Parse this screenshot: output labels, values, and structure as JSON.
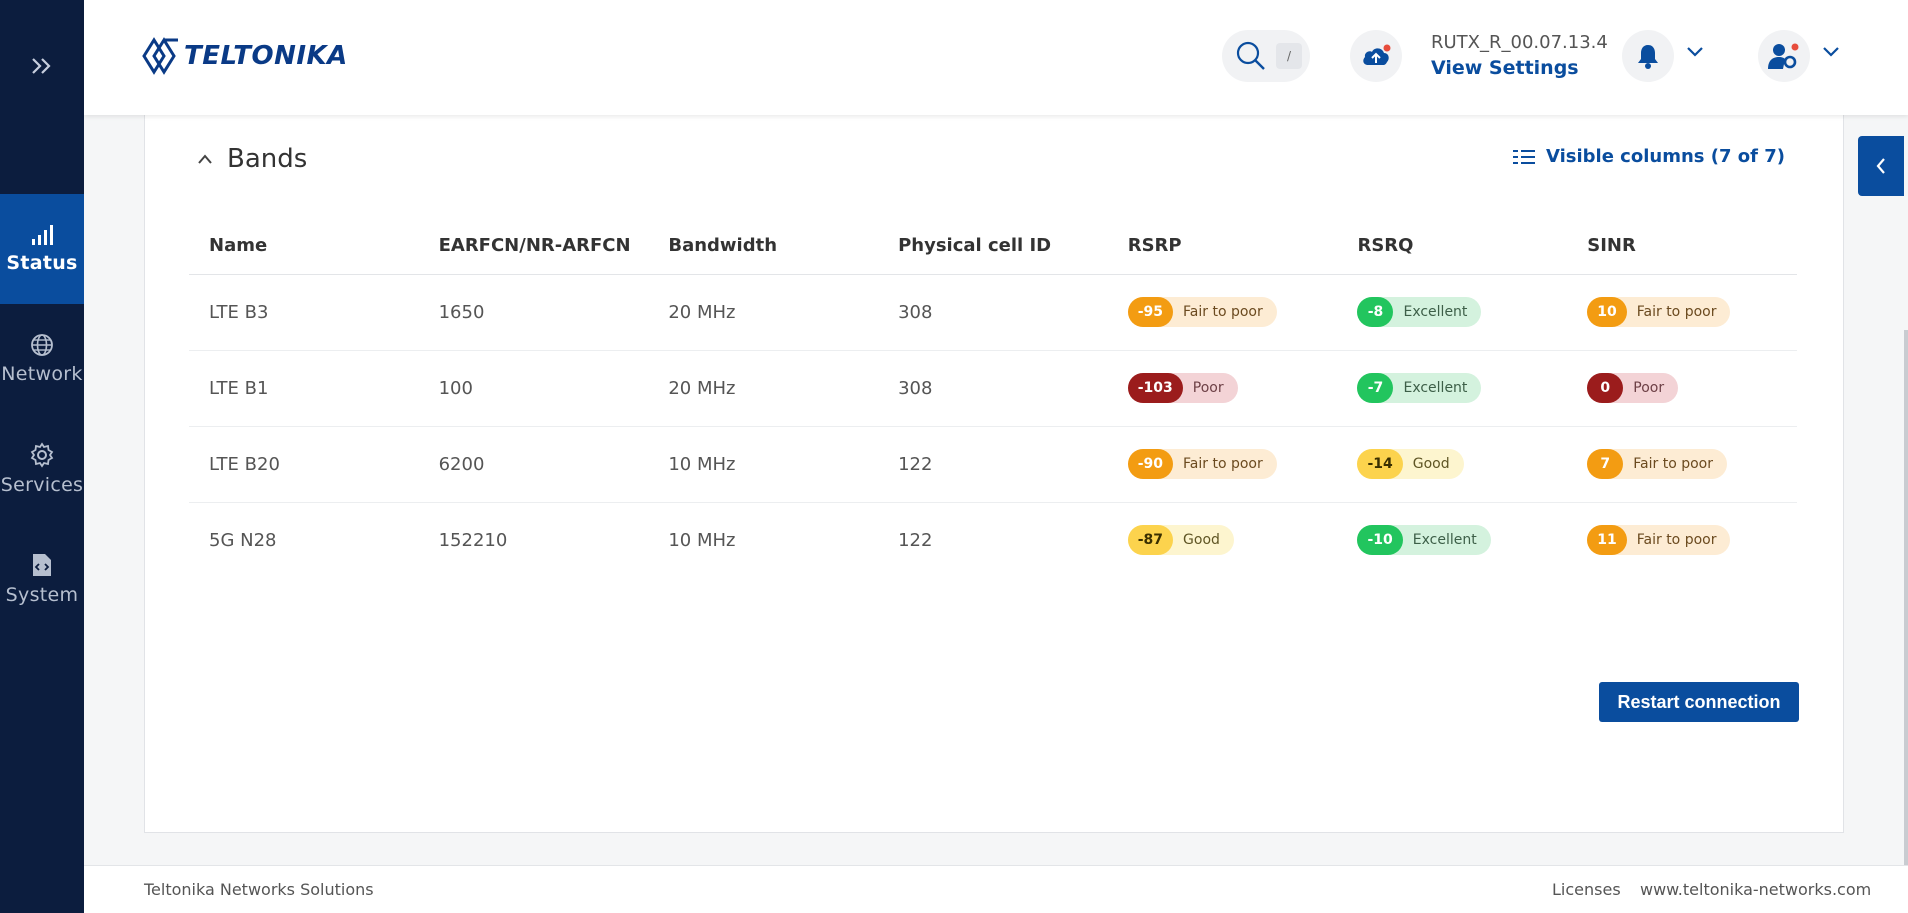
{
  "sidebar": {
    "items": [
      {
        "label": "Status",
        "icon": "signal-bars-icon",
        "active": true
      },
      {
        "label": "Network",
        "icon": "globe-icon",
        "active": false
      },
      {
        "label": "Services",
        "icon": "gear-icon",
        "active": false
      },
      {
        "label": "System",
        "icon": "file-code-icon",
        "active": false
      }
    ]
  },
  "header": {
    "brand": "TELTONIKA",
    "search_shortcut": "/",
    "firmware_version": "RUTX_R_00.07.13.4",
    "view_settings": "View Settings"
  },
  "card": {
    "title": "Bands",
    "visible_columns": "Visible columns (7 of 7)",
    "columns": [
      "Name",
      "EARFCN/NR-ARFCN",
      "Bandwidth",
      "Physical cell ID",
      "RSRP",
      "RSRQ",
      "SINR"
    ],
    "rows": [
      {
        "name": "LTE B3",
        "earfcn": "1650",
        "bandwidth": "20 MHz",
        "pci": "308",
        "rsrp": {
          "value": "-95",
          "label": "Fair to poor",
          "level": "orange"
        },
        "rsrq": {
          "value": "-8",
          "label": "Excellent",
          "level": "green"
        },
        "sinr": {
          "value": "10",
          "label": "Fair to poor",
          "level": "orange"
        }
      },
      {
        "name": "LTE B1",
        "earfcn": "100",
        "bandwidth": "20 MHz",
        "pci": "308",
        "rsrp": {
          "value": "-103",
          "label": "Poor",
          "level": "red"
        },
        "rsrq": {
          "value": "-7",
          "label": "Excellent",
          "level": "green"
        },
        "sinr": {
          "value": "0",
          "label": "Poor",
          "level": "red"
        }
      },
      {
        "name": "LTE B20",
        "earfcn": "6200",
        "bandwidth": "10 MHz",
        "pci": "122",
        "rsrp": {
          "value": "-90",
          "label": "Fair to poor",
          "level": "orange"
        },
        "rsrq": {
          "value": "-14",
          "label": "Good",
          "level": "yellow"
        },
        "sinr": {
          "value": "7",
          "label": "Fair to poor",
          "level": "orange"
        }
      },
      {
        "name": "5G N28",
        "earfcn": "152210",
        "bandwidth": "10 MHz",
        "pci": "122",
        "rsrp": {
          "value": "-87",
          "label": "Good",
          "level": "yellow"
        },
        "rsrq": {
          "value": "-10",
          "label": "Excellent",
          "level": "green"
        },
        "sinr": {
          "value": "11",
          "label": "Fair to poor",
          "level": "orange"
        }
      }
    ],
    "restart_button": "Restart connection"
  },
  "footer": {
    "company": "Teltonika Networks Solutions",
    "licenses": "Licenses",
    "website": "www.teltonika-networks.com"
  },
  "colors": {
    "sidebar_bg": "#0c1d3e",
    "accent": "#0a4d9e",
    "badge_orange": "#f39c12",
    "badge_green": "#22c55e",
    "badge_red": "#9b1c1c",
    "badge_yellow": "#fcd34d"
  }
}
